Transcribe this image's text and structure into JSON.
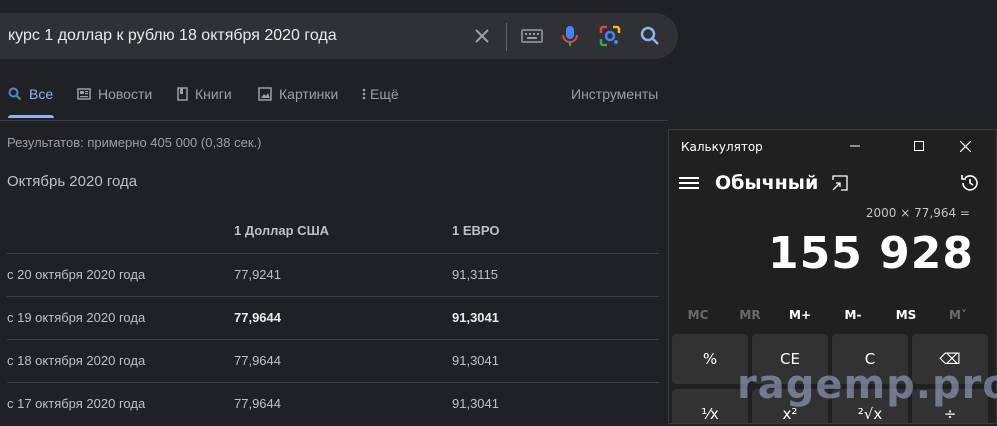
{
  "search": {
    "query": "курс 1 доллар к рублю 18 октября 2020 года",
    "icons": [
      "close-icon",
      "keyboard-icon",
      "mic-icon",
      "lens-icon",
      "search-icon"
    ]
  },
  "tabs": [
    {
      "label": "Все",
      "icon": "google-icon",
      "active": true
    },
    {
      "label": "Новости",
      "icon": "news-icon"
    },
    {
      "label": "Книги",
      "icon": "book-icon"
    },
    {
      "label": "Картинки",
      "icon": "image-icon"
    },
    {
      "label": "Ещё",
      "icon": "more-vert-icon"
    }
  ],
  "tools_label": "Инструменты",
  "result_stats": "Результатов: примерно 405 000 (0,38 сек.)",
  "section_title": "Октябрь 2020 года",
  "table": {
    "headers": [
      "1 Доллар США",
      "1 ЕВРО"
    ],
    "rows": [
      {
        "date": "с 20 октября 2020 года",
        "usd": "77,9241",
        "eur": "91,3115",
        "bold": false
      },
      {
        "date": "с 19 октября 2020 года",
        "usd": "77,9644",
        "eur": "91,3041",
        "bold": true
      },
      {
        "date": "с 18 октября 2020 года",
        "usd": "77,9644",
        "eur": "91,3041",
        "bold": false
      },
      {
        "date": "с 17 октября 2020 года",
        "usd": "77,9644",
        "eur": "91,3041",
        "bold": false
      }
    ]
  },
  "calculator": {
    "title": "Калькулятор",
    "mode": "Обычный",
    "expression": "2000 × 77,964 =",
    "display": "155 928",
    "memory": [
      "MC",
      "MR",
      "M+",
      "M-",
      "MS",
      "M˅"
    ],
    "keys_row1": [
      "%",
      "CE",
      "C",
      "⌫"
    ],
    "keys_row2": [
      "⅟x",
      "x²",
      "²√x",
      "÷"
    ]
  },
  "watermark": "ragemp.pro",
  "colors": {
    "background": "#202124",
    "accent": "#8ab4f8",
    "calc_bg": "#202020"
  }
}
